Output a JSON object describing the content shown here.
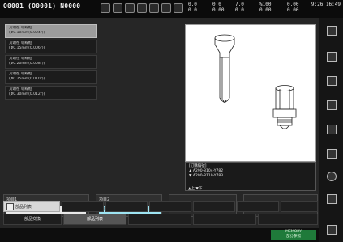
{
  "topbar": {
    "program": "O0001 (O0001) N0000",
    "status_col1": "0.0\n0.0",
    "status_col2": "0.0\n0.00",
    "status_col3": "7.0\n0.0",
    "status_col4": "%100\n0.00",
    "status_col5": "0.00\n0.00",
    "clock": "9:26\n16:49"
  },
  "left_list": [
    {
      "line1": "刀頭徑 導線框",
      "line2": "(Φ0.10mm(0.004\"))"
    },
    {
      "line1": "刀頭徑 導線框",
      "line2": "(Φ0.15mm(0.006\"))"
    },
    {
      "line1": "刀頭徑 導線框",
      "line2": "(Φ0.20mm(0.008\"))"
    },
    {
      "line1": "刀頭徑 導線框",
      "line2": "(Φ0.25mm(0.010\"))"
    },
    {
      "line1": "刀頭徑 導線框",
      "line2": "(Φ0.30mm(0.012\"))"
    }
  ],
  "info": {
    "title": "[訂購編號]",
    "line_up": "▲ A290-8104-Y782",
    "line_down": "▼ A290-8119-Y783",
    "arrows": "▲上 ▼下"
  },
  "steps": {
    "step1_label": "項目1",
    "step1_value": "導絲自行穿線, 導線嘴",
    "step2_label": "項目2",
    "step2_value": "導線嘴"
  },
  "tabs": {
    "active": "部品列表",
    "row2_a": "部品交換",
    "row2_b": "部品列表"
  },
  "bottom": {
    "mem_line1": "MEMORY",
    "mem_line2": "部分參照"
  }
}
